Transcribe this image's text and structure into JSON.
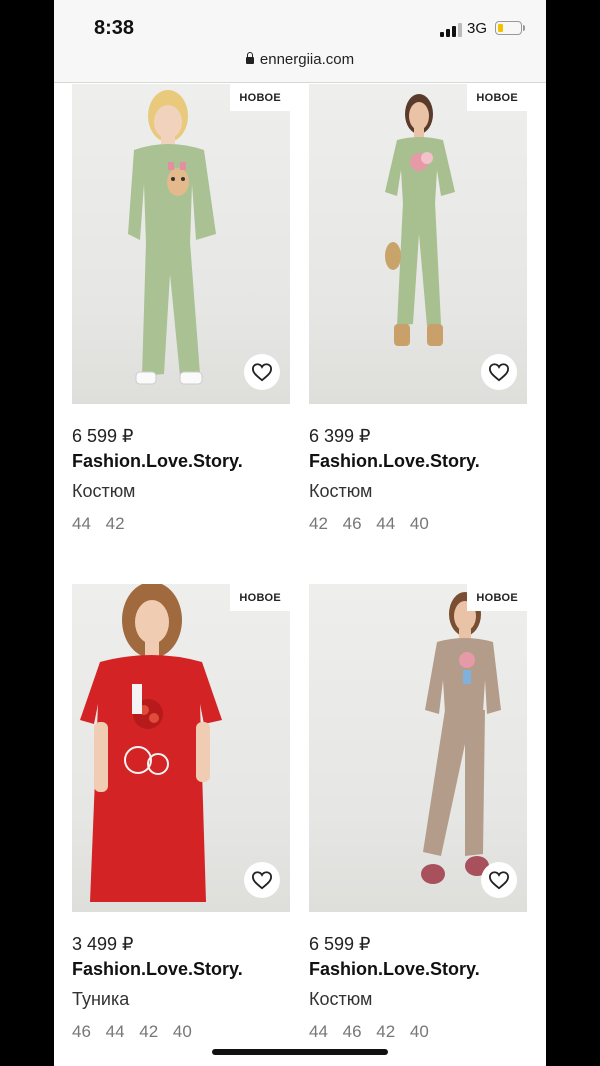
{
  "status_bar": {
    "time": "8:38",
    "network": "3G",
    "url": "ennergiia.com"
  },
  "products": [
    {
      "badge": "НОВОЕ",
      "price": "6 599 ₽",
      "brand": "Fashion.Love.Story.",
      "type": "Костюм",
      "sizes": "44 42",
      "garment_color": "#a9c193",
      "favorite_icon": "heart-icon"
    },
    {
      "badge": "НОВОЕ",
      "price": "6 399 ₽",
      "brand": "Fashion.Love.Story.",
      "type": "Костюм",
      "sizes": "42 46 44 40",
      "garment_color": "#a8c08f",
      "favorite_icon": "heart-icon"
    },
    {
      "badge": "НОВОЕ",
      "price": "3 499 ₽",
      "brand": "Fashion.Love.Story.",
      "type": "Туника",
      "sizes": "46 44 42 40",
      "garment_color": "#d42325",
      "favorite_icon": "heart-icon"
    },
    {
      "badge": "НОВОЕ",
      "price": "6 599 ₽",
      "brand": "Fashion.Love.Story.",
      "type": "Костюм",
      "sizes": "44 46 42 40",
      "garment_color": "#b49c8a",
      "favorite_icon": "heart-icon"
    }
  ]
}
